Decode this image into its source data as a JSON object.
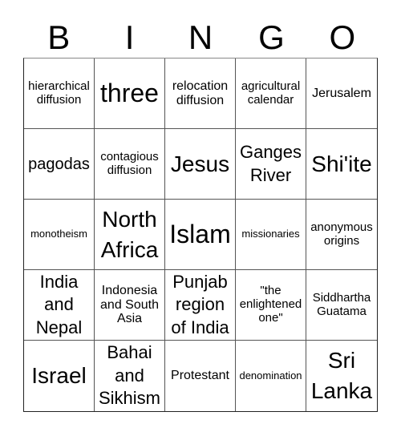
{
  "header": [
    "B",
    "I",
    "N",
    "G",
    "O"
  ],
  "cells": [
    "hierarchical diffusion",
    "three",
    "relocation diffusion",
    "agricultural calendar",
    "Jerusalem",
    "pagodas",
    "contagious diffusion",
    "Jesus",
    "Ganges River",
    "Shi'ite",
    "monotheism",
    "North Africa",
    "Islam",
    "missionaries",
    "anonymous origins",
    "India and Nepal",
    "Indonesia and South Asia",
    "Punjab region of India",
    "\"the enlightened one\"",
    "Siddhartha Guatama",
    "Israel",
    "Bahai and Sikhism",
    "Protestant",
    "denomination",
    "Sri Lanka"
  ]
}
